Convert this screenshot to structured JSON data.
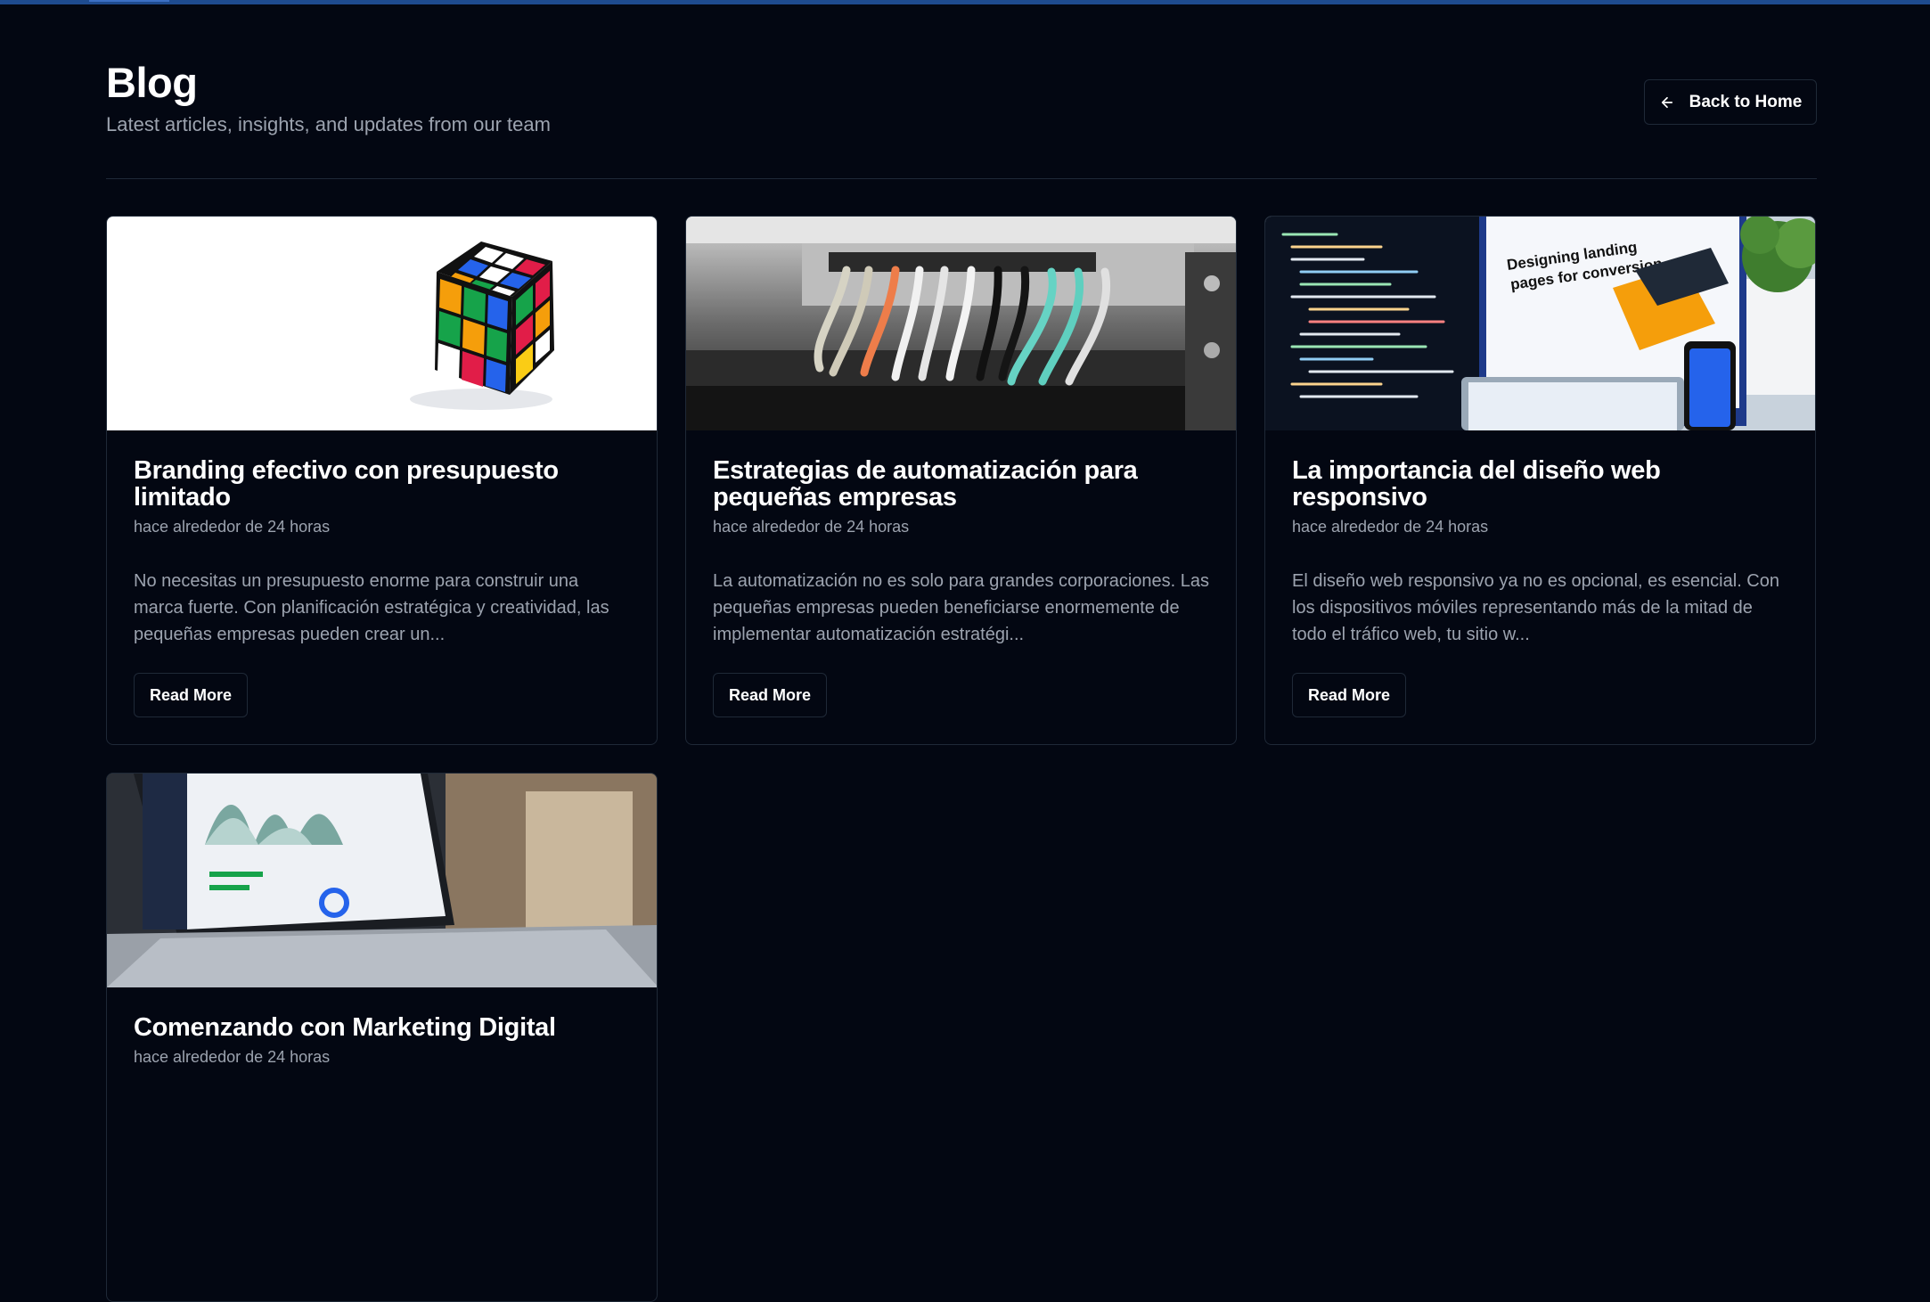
{
  "header": {
    "title": "Blog",
    "subtitle": "Latest articles, insights, and updates from our team",
    "back_label": "Back to Home"
  },
  "posts": [
    {
      "title": "Branding efectivo con presupuesto limitado",
      "date": "hace alrededor de 24 horas",
      "excerpt": "No necesitas un presupuesto enorme para construir una marca fuerte. Con planificación estratégica y creatividad, las pequeñas empresas pueden crear un...",
      "read_label": "Read More",
      "image": "rubiks-cube-photo"
    },
    {
      "title": "Estrategias de automatización para pequeñas empresas",
      "date": "hace alrededor de 24 horas",
      "excerpt": "La automatización no es solo para grandes corporaciones. Las pequeñas empresas pueden beneficiarse enormemente de implementar automatización estratégi...",
      "read_label": "Read More",
      "image": "network-switch-cables-photo"
    },
    {
      "title": "La importancia del diseño web responsivo",
      "date": "hace alrededor de 24 horas",
      "excerpt": "El diseño web responsivo ya no es opcional, es esencial. Con los dispositivos móviles representando más de la mitad de todo el tráfico web, tu sitio w...",
      "read_label": "Read More",
      "image": "responsive-devices-photo",
      "image_text": "Designing landing pages for conversion"
    },
    {
      "title": "Comenzando con Marketing Digital",
      "date": "hace alrededor de 24 horas",
      "image": "laptop-dashboard-photo"
    }
  ],
  "colors": {
    "background": "#030712",
    "border": "#1f2937",
    "muted_text": "#9ca3af",
    "topbar": "#1e4b8f"
  }
}
